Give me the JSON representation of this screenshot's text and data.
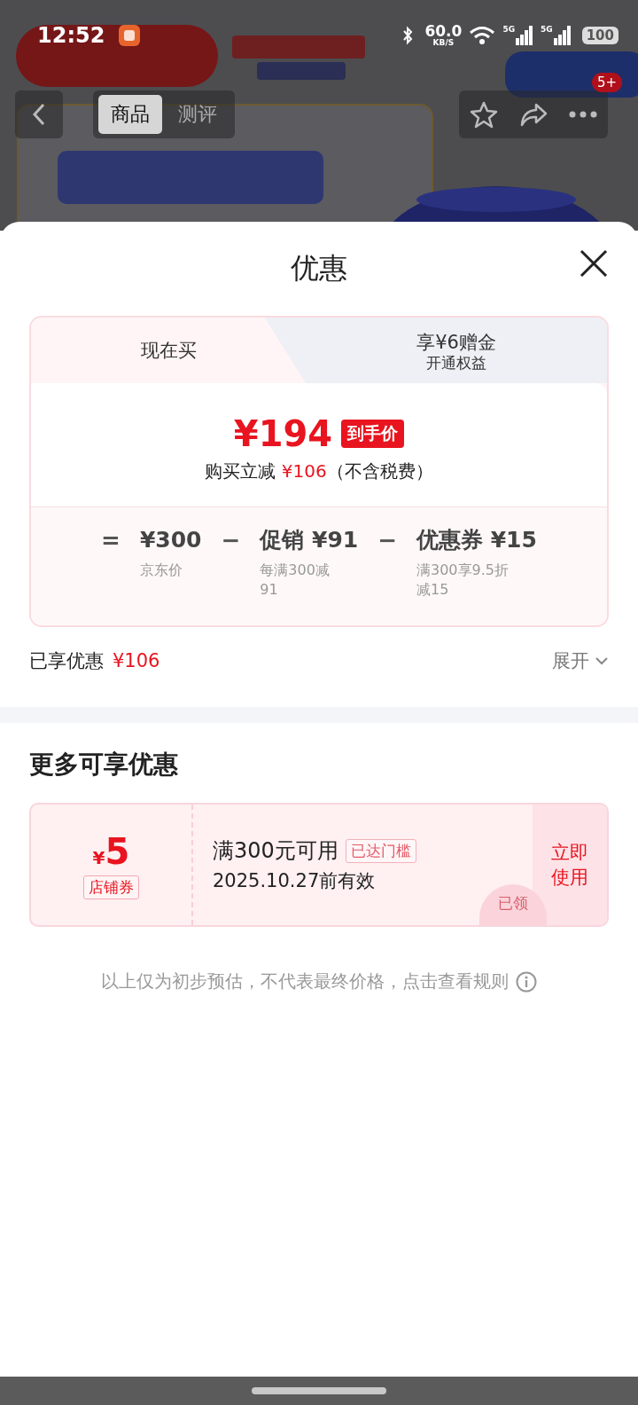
{
  "status_bar": {
    "time": "12:52",
    "net_speed": "60.0",
    "net_unit": "KB/S",
    "sim_1": "5G",
    "sim_2": "5G",
    "battery": "100"
  },
  "header": {
    "tabs": [
      {
        "label": "商品",
        "selected": true
      },
      {
        "label": "测评",
        "selected": false
      }
    ],
    "more_badge": "5+"
  },
  "sheet": {
    "title": "优惠",
    "mode_tabs": [
      {
        "label": "现在买",
        "selected": true
      },
      {
        "label": "享¥6赠金",
        "sublabel": "开通权益",
        "selected": false
      }
    ],
    "final_price": "¥194",
    "final_price_tag": "到手价",
    "saving_prefix": "购买立减",
    "saving_amount": "¥106",
    "saving_note": "（不含税费）",
    "breakdown": [
      {
        "operator": "=",
        "amount": "¥300",
        "note_lines": [
          "京东价"
        ]
      },
      {
        "operator": "−",
        "label": "促销",
        "amount": "¥91",
        "note_lines": [
          "每满300减",
          "91"
        ]
      },
      {
        "operator": "−",
        "label": "优惠券",
        "amount": "¥15",
        "note_lines": [
          "满300享9.5折",
          "减15"
        ]
      }
    ],
    "enjoyed_label": "已享优惠",
    "enjoyed_amount": "¥106",
    "expand_label": "展开",
    "more_title": "更多可享优惠",
    "coupons": [
      {
        "currency": "¥",
        "amount": "5",
        "type": "店铺券",
        "condition": "满300元可用",
        "status_tag": "已达门槛",
        "validity": "2025.10.27前有效",
        "action": "立即使用",
        "stamp": "已领"
      }
    ],
    "disclaimer": "以上仅为初步预估，不代表最终价格，点击查看规则"
  }
}
